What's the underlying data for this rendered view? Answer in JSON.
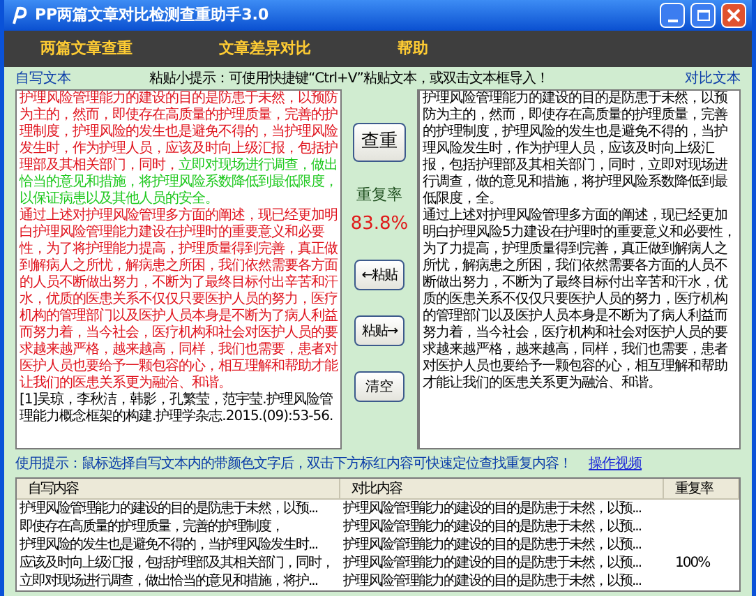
{
  "window": {
    "title": "PP两篇文章对比检测查重助手3.0"
  },
  "menu": [
    {
      "label": "两篇文章查重"
    },
    {
      "label": "文章差异对比"
    },
    {
      "label": "帮助"
    }
  ],
  "left_label": "自写文本",
  "paste_tip": "粘贴小提示：可使用快捷键“Ctrl+V”粘贴文本，或双击文本框导入！",
  "right_label": "对比文本",
  "left_text": [
    {
      "segments": [
        {
          "kind": "dup",
          "text": "护理风险管理能力的建设的目的是防患于未然，以预防为主的，然而，即使存在高质量的护理质量，完善的护理制度，护理风险的发生也是避免不得的，当护理风险发生时，作为护理人员，应该及时向上级汇报，包括护理部及其相关部门，同时，"
        },
        {
          "kind": "partial",
          "text": "立即对现场进行调查，做出恰当的意见和措施，将护理风险系数降低到最低限度，以保证病患以及其他人员的安全。"
        }
      ]
    },
    {
      "segments": [
        {
          "kind": "dup",
          "text": "通过上述对护理风险管理多方面的阐述，现已经更加明白护理风险管理能力建设在护理时的重要意义和必要性，为了将护理能力提高，护理质量得到完善，真正做到解病人之所忧，解病患之所困，我们依然需要各方面的人员不断做出努力，不断为了最终目标付出辛苦和汗水，优质的医患关系不仅仅只要医护人员的努力，医疗机构的管理部门以及医护人员本身是不断为了病人利益而努力着，当今社会，医疗机构和社会对医护人员的要求越来越严格，越来越高，同样，我们也需要，患者对医护人员也要给予一颗包容的心，相互理解和帮助才能让我们的医患关系更为融洽、和谐。"
        }
      ]
    },
    {
      "segments": [
        {
          "kind": "plain",
          "text": "[1]吴琼，李秋洁，韩影，孔繁莹，范宇莹.护理风险管理能力概念框架的构建.护理学杂志.2015.(09):53-56."
        }
      ]
    }
  ],
  "right_text": [
    "护理风险管理能力的建设的目的是防患于未然，以预防为主的，然而，即使存在高质量的护理质量，完善的护理制度，护理风险的发生也是避免不得的，当护理风险发生时，作为护理人员，应该及时向上级汇报，包括护理部及其相关部门，同时，立即对现场进行调查，做的意见和措施，将护理风险系数降低到最低限度，全。",
    "通过上述对护理风险管理多方面的阐述，现已经更加明白护理风险5力建设在护理时的重要意义和必要性，为了力提高，护理质量得到完善，真正做到解病人之所忧，解病患之所困，我们依然需要各方面的人员不断做出努力，不断为了最终目标付出辛苦和汗水，优质的医患关系不仅仅只要医护人员的努力，医疗机构的管理部门以及医护人员本身是不断为了病人利益而努力着，当今社会，医疗机构和社会对医护人员的要求越来越严格，越来越高，同样，我们也需要，患者对医护人员也要给予一颗包容的心，相互理解和帮助才能让我们的医患关系更为融洽、和谐。"
  ],
  "buttons": {
    "check": "查重",
    "rate_label": "重复率",
    "rate": "83.8%",
    "paste_left": "←粘贴",
    "paste_right": "粘贴→",
    "clear": "清空"
  },
  "usage_tip": "使用提示：鼠标选择自写文本内的带颜色文字后，双击下方标红内容可快速定位查找重复内容！",
  "video_link": "操作视频",
  "table": {
    "columns": [
      "自写内容",
      "对比内容",
      "重复率"
    ],
    "rows": [
      {
        "self": "护理风险管理能力的建设的目的是防患于未然，以预...",
        "compare": "护理风险管理能力的建设的目的是防患于未然，以预...",
        "rate": ""
      },
      {
        "self": "即使存在高质量的护理质量，完善的护理制度，",
        "compare": "护理风险管理能力的建设的目的是防患于未然，以预...",
        "rate": ""
      },
      {
        "self": "护理风险的发生也是避免不得的，当护理风险发生时...",
        "compare": "护理风险管理能力的建设的目的是防患于未然，以预...",
        "rate": ""
      },
      {
        "self": "应该及时向上级汇报，包括护理部及其相关部门，同时，",
        "compare": "护理风险管理能力的建设的目的是防患于未然，以预...",
        "rate": "100%"
      },
      {
        "self": "立即对现场进行调查，做出恰当的意见和措施，将护...",
        "compare": "护理风险管理能力的建设的目的是防患于未然，以预...",
        "rate": ""
      }
    ]
  }
}
